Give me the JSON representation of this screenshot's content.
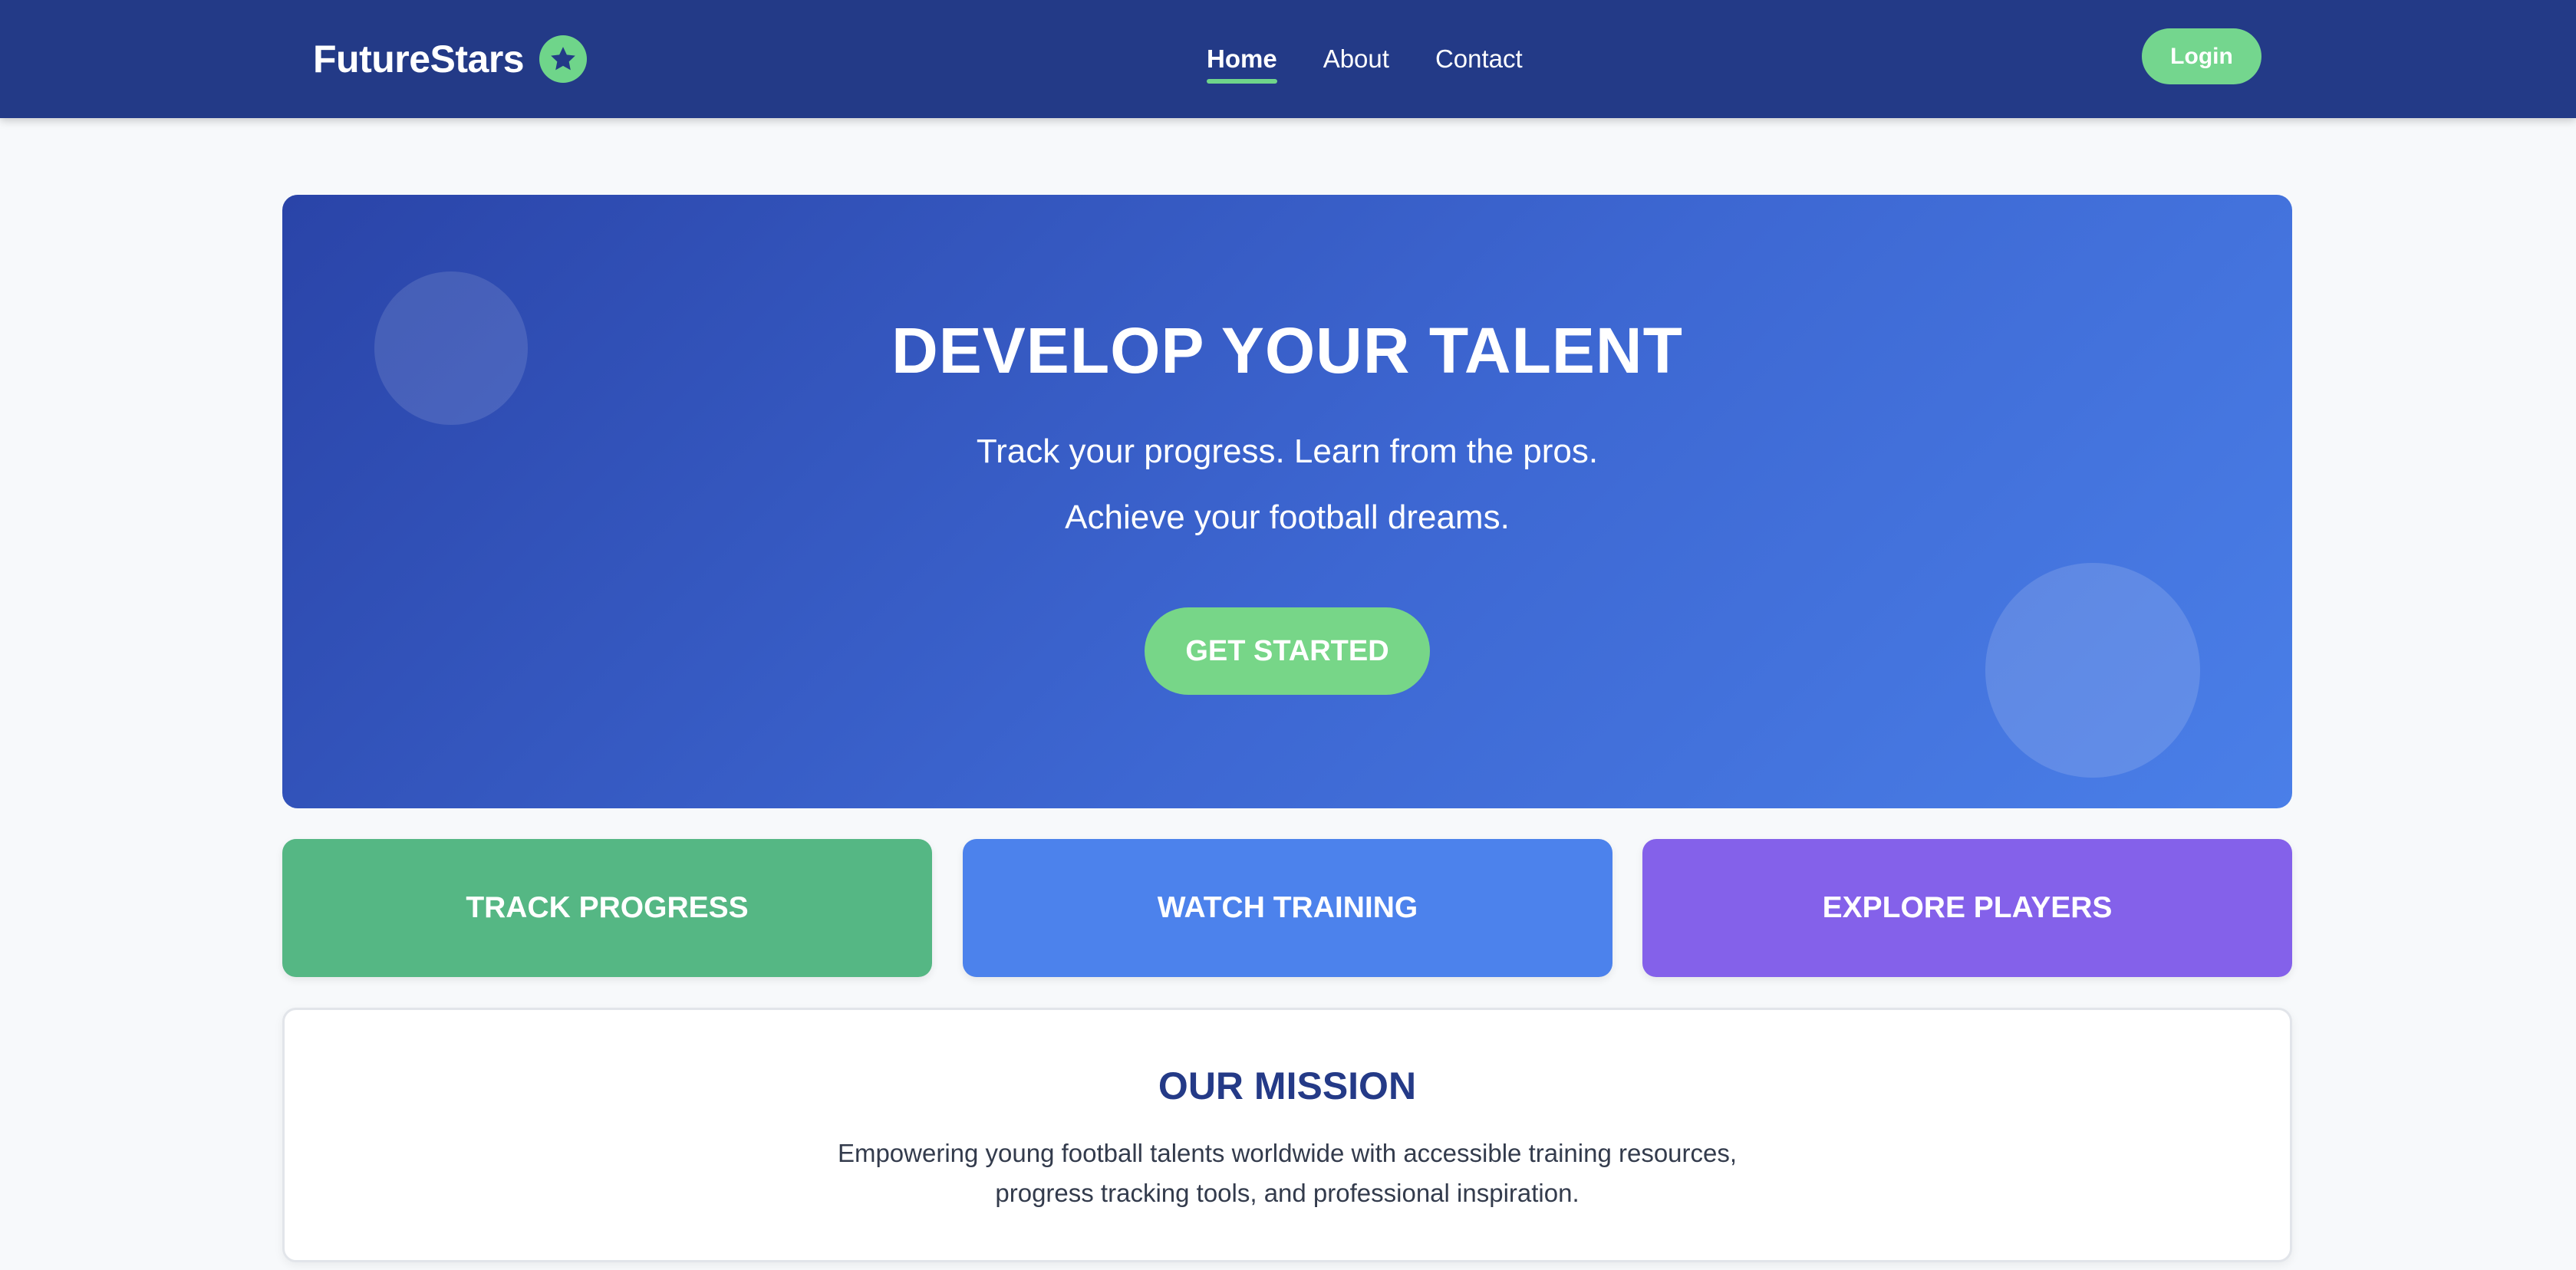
{
  "navbar": {
    "brand": "FutureStars",
    "brand_icon": "star-icon",
    "links": [
      {
        "label": "Home",
        "active": true
      },
      {
        "label": "About",
        "active": false
      },
      {
        "label": "Contact",
        "active": false
      }
    ],
    "login_label": "Login"
  },
  "hero": {
    "title": "DEVELOP YOUR TALENT",
    "subtitle_line1": "Track your progress. Learn from the pros.",
    "subtitle_line2": "Achieve your football dreams.",
    "cta_label": "GET STARTED"
  },
  "features": [
    {
      "label": "TRACK PROGRESS",
      "color": "#55b784"
    },
    {
      "label": "WATCH TRAINING",
      "color": "#4c82ec"
    },
    {
      "label": "EXPLORE PLAYERS",
      "color": "#8461ea"
    }
  ],
  "mission": {
    "title": "OUR MISSION",
    "text_line1": "Empowering young football talents worldwide with accessible training resources,",
    "text_line2": "progress tracking tools, and professional inspiration."
  },
  "colors": {
    "navbar_bg": "#233a87",
    "accent_green": "#6fd58a",
    "hero_gradient_start": "#2a44a8",
    "hero_gradient_end": "#4a7fe8",
    "page_bg": "#f7f9fb"
  }
}
